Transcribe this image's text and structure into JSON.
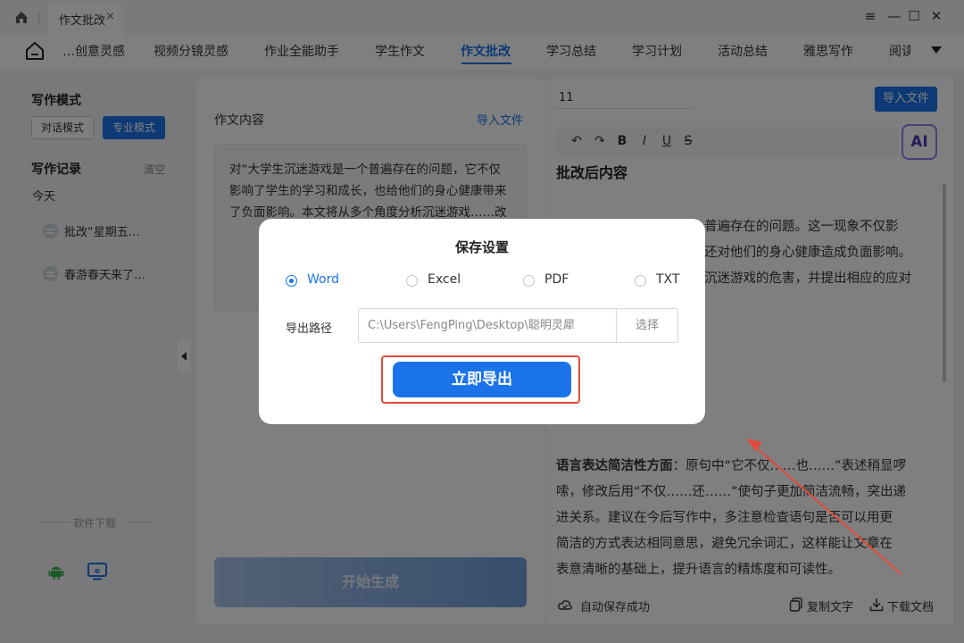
{
  "titlebar": {
    "tab_label": "作文批改",
    "tab_close": "×",
    "minimize": "—",
    "restore": "☐",
    "close": "✕",
    "menu": "≡"
  },
  "nav": {
    "items": [
      "…创意灵感",
      "视频分镜灵感",
      "作业全能助手",
      "学生作文",
      "作文批改",
      "学习总结",
      "学习计划",
      "活动总结",
      "雅思写作",
      "阅读…"
    ],
    "active_index": 4
  },
  "sidebar": {
    "mode_title": "写作模式",
    "mode_chat": "对话模式",
    "mode_pro": "专业模式",
    "records_title": "写作记录",
    "clear": "清空",
    "today": "今天",
    "records": [
      "批改“星期五…",
      "春游春天来了…"
    ],
    "download_label": "软件下载"
  },
  "middle": {
    "label": "作文内容",
    "import": "导入文件",
    "essay_text": "对“大学生沉迷游戏是一个普遍存在的问题，它不仅影响了学生的学习和成长，也给他们的身心健康带来了负面影响。本文将从多个角度分析沉迷游戏……改",
    "generate": "开始生成"
  },
  "right": {
    "input_value": "11",
    "import": "导入文件",
    "tools": [
      "↶",
      "↷",
      "B",
      "I",
      "U",
      "S"
    ],
    "ai": "AI",
    "title": "批改后内容",
    "para1_lines": [
      "普遍存在的问题。这一现象不仅影",
      "还对他们的身心健康造成负面影响。",
      "沉迷游戏的危害，并提出相应的应对"
    ],
    "para2_bold": "语言表达简洁性方面",
    "para2_lines": [
      "：原句中“它不仅……也……”表述稍显啰",
      "嗦，修改后用“不仅……还……”使句子更加简洁流畅，突出递",
      "进关系。建议在今后写作中，多注意检查语句是否可以用更",
      "简洁的方式表达相同意思，避免冗余词汇，这样能让文章在",
      "表意清晰的基础上，提升语言的精炼度和可读性。"
    ],
    "autosave": "自动保存成功",
    "copy": "复制文字",
    "download": "下载文档"
  },
  "dialog": {
    "title": "保存设置",
    "formats": [
      "Word",
      "Excel",
      "PDF",
      "TXT"
    ],
    "selected_format": "Word",
    "path_label": "导出路径",
    "path_value": "C:\\Users\\FengPing\\Desktop\\聪明灵犀",
    "choose": "选择",
    "export": "立即导出"
  },
  "colors": {
    "accent": "#1a73e8",
    "highlight": "#e24b3b"
  }
}
